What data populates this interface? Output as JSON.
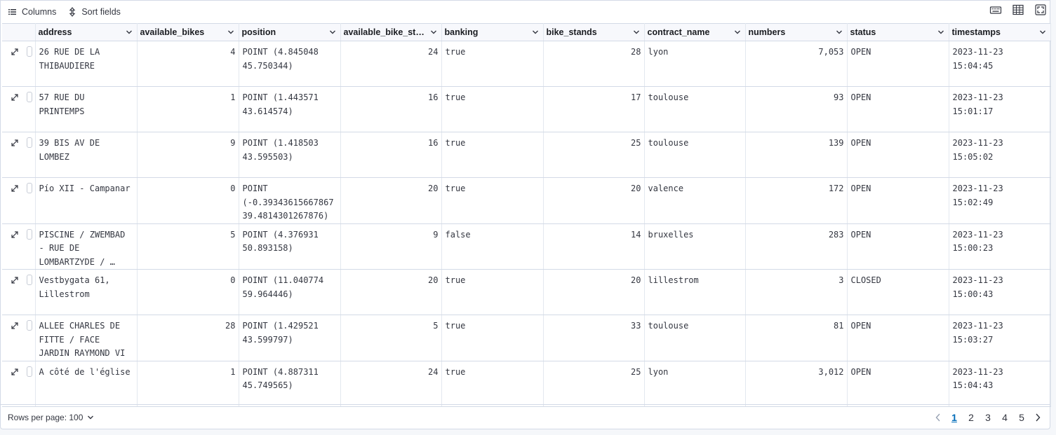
{
  "toolbar": {
    "columns_label": "Columns",
    "sort_label": "Sort fields",
    "columns_icon": "list-icon",
    "sort_icon": "sort-arrows-icon",
    "right_icons": [
      "keyboard-icon",
      "table-density-icon",
      "fullscreen-icon"
    ]
  },
  "columns": [
    "address",
    "available_bikes",
    "position",
    "available_bike_sta…",
    "banking",
    "bike_stands",
    "contract_name",
    "numbers",
    "status",
    "timestamps"
  ],
  "rows": [
    {
      "address": "26 RUE DE LA THIBAUDIERE",
      "available_bikes": "4",
      "position": "POINT (4.845048 45.750344)",
      "available_bike_stands": "24",
      "banking": "true",
      "bike_stands": "28",
      "contract_name": "lyon",
      "numbers": "7,053",
      "status": "OPEN",
      "timestamps": "2023-11-23 15:04:45"
    },
    {
      "address": "57 RUE DU PRINTEMPS",
      "available_bikes": "1",
      "position": "POINT (1.443571 43.614574)",
      "available_bike_stands": "16",
      "banking": "true",
      "bike_stands": "17",
      "contract_name": "toulouse",
      "numbers": "93",
      "status": "OPEN",
      "timestamps": "2023-11-23 15:01:17"
    },
    {
      "address": "39 BIS AV DE LOMBEZ",
      "available_bikes": "9",
      "position": "POINT (1.418503 43.595503)",
      "available_bike_stands": "16",
      "banking": "true",
      "bike_stands": "25",
      "contract_name": "toulouse",
      "numbers": "139",
      "status": "OPEN",
      "timestamps": "2023-11-23 15:05:02"
    },
    {
      "address": "Pío XII - Campanar",
      "available_bikes": "0",
      "position": "POINT (-0.39343615667867 39.4814301267876)",
      "available_bike_stands": "20",
      "banking": "true",
      "bike_stands": "20",
      "contract_name": "valence",
      "numbers": "172",
      "status": "OPEN",
      "timestamps": "2023-11-23 15:02:49"
    },
    {
      "address": "PISCINE / ZWEMBAD - RUE DE LOMBARTZYDE / …",
      "available_bikes": "5",
      "position": "POINT (4.376931 50.893158)",
      "available_bike_stands": "9",
      "banking": "false",
      "bike_stands": "14",
      "contract_name": "bruxelles",
      "numbers": "283",
      "status": "OPEN",
      "timestamps": "2023-11-23 15:00:23"
    },
    {
      "address": "Vestbygata 61, Lillestrom",
      "available_bikes": "0",
      "position": "POINT (11.040774 59.964446)",
      "available_bike_stands": "20",
      "banking": "true",
      "bike_stands": "20",
      "contract_name": "lillestrom",
      "numbers": "3",
      "status": "CLOSED",
      "timestamps": "2023-11-23 15:00:43"
    },
    {
      "address": "ALLEE CHARLES DE FITTE / FACE JARDIN RAYMOND VI",
      "available_bikes": "28",
      "position": "POINT (1.429521 43.599797)",
      "available_bike_stands": "5",
      "banking": "true",
      "bike_stands": "33",
      "contract_name": "toulouse",
      "numbers": "81",
      "status": "OPEN",
      "timestamps": "2023-11-23 15:03:27"
    },
    {
      "address": "A côté de l'église",
      "available_bikes": "1",
      "position": "POINT (4.887311 45.749565)",
      "available_bike_stands": "24",
      "banking": "true",
      "bike_stands": "25",
      "contract_name": "lyon",
      "numbers": "3,012",
      "status": "OPEN",
      "timestamps": "2023-11-23 15:04:43"
    }
  ],
  "footer": {
    "rows_per_page_label": "Rows per page: 100",
    "pages": [
      "1",
      "2",
      "3",
      "4",
      "5"
    ],
    "current_page": "1"
  },
  "colors": {
    "accent": "#006bb8",
    "border": "#d3dae6",
    "header_bg": "#f7f8fc"
  }
}
